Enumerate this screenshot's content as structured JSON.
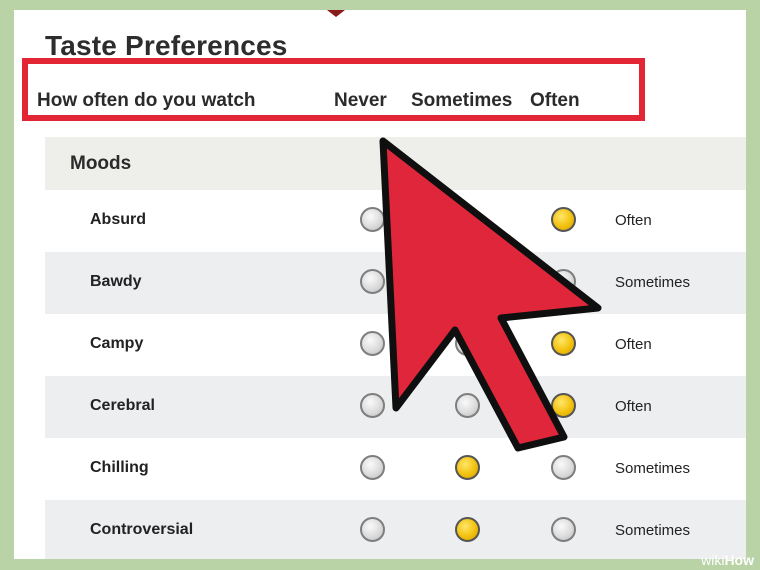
{
  "page": {
    "title": "Taste Preferences"
  },
  "header": {
    "question": "How often do you watch",
    "col_never": "Never",
    "col_sometimes": "Sometimes",
    "col_often": "Often"
  },
  "section": {
    "label": "Moods"
  },
  "rows": [
    {
      "label": "Absurd",
      "selected": "often",
      "value": "Often"
    },
    {
      "label": "Bawdy",
      "selected": "sometimes",
      "value": "Sometimes"
    },
    {
      "label": "Campy",
      "selected": "often",
      "value": "Often"
    },
    {
      "label": "Cerebral",
      "selected": "often",
      "value": "Often"
    },
    {
      "label": "Chilling",
      "selected": "sometimes",
      "value": "Sometimes"
    },
    {
      "label": "Controversial",
      "selected": "sometimes",
      "value": "Sometimes"
    }
  ],
  "colors": {
    "highlight_border": "#e32636",
    "arrow_fill": "#e0263a",
    "radio_selected": "#f2c10d",
    "background": "#b9d3a6"
  },
  "overlay": {
    "icon": "pointer-arrow-icon"
  },
  "watermark": {
    "wiki": "wiki",
    "how": "How"
  }
}
